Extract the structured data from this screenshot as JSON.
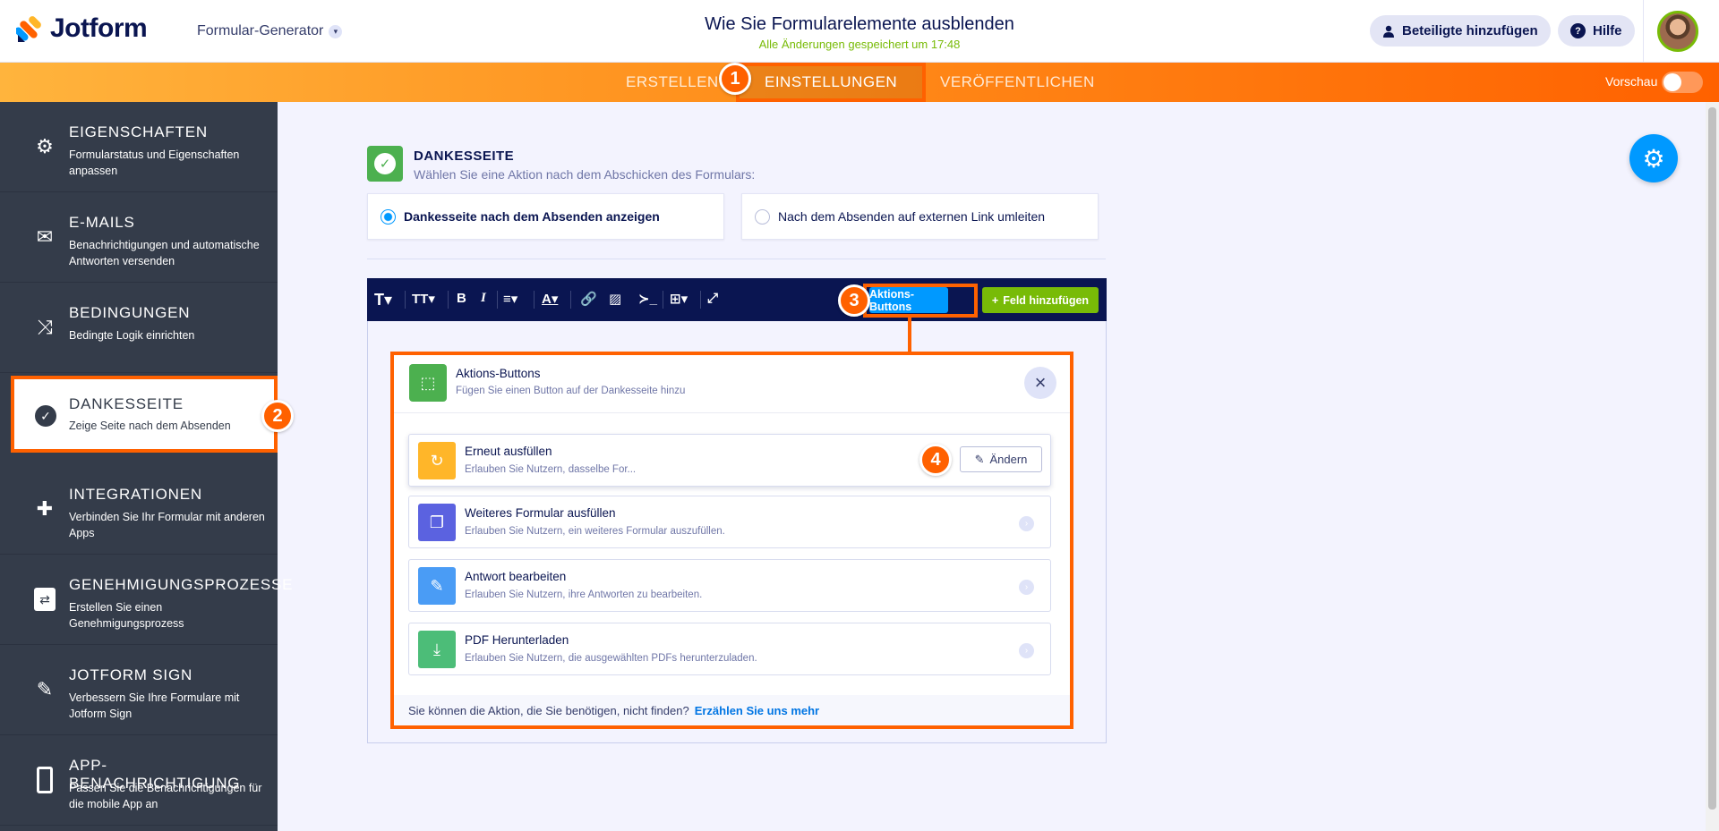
{
  "header": {
    "logo_text": "Jotform",
    "builder_label": "Formular-Generator",
    "form_title": "Wie Sie Formularelemente ausblenden",
    "saved_status": "Alle Änderungen gespeichert um 17:48",
    "invite_label": "Beteiligte hinzufügen",
    "help_label": "Hilfe"
  },
  "nav": {
    "tabs": [
      {
        "label": "ERSTELLEN"
      },
      {
        "label": "EINSTELLUNGEN"
      },
      {
        "label": "VERÖFFENTLICHEN"
      }
    ],
    "preview_label": "Vorschau"
  },
  "badges": [
    "1",
    "2",
    "3",
    "4"
  ],
  "sidebar": {
    "items": [
      {
        "title": "EIGENSCHAFTEN",
        "subtitle": "Formularstatus und Eigenschaften anpassen",
        "icon": "gear-icon"
      },
      {
        "title": "E-MAILS",
        "subtitle": "Benachrichtigungen und automatische Antworten versenden",
        "icon": "envelope-icon"
      },
      {
        "title": "BEDINGUNGEN",
        "subtitle": "Bedingte Logik einrichten",
        "icon": "shuffle-icon"
      },
      {
        "title": "DANKESSEITE",
        "subtitle": "Zeige Seite nach dem Absenden",
        "icon": "check-circle-icon"
      },
      {
        "title": "INTEGRATIONEN",
        "subtitle": "Verbinden Sie Ihr Formular mit anderen Apps",
        "icon": "puzzle-icon"
      },
      {
        "title": "GENEHMIGUNGSPROZESSE",
        "subtitle": "Erstellen Sie einen Genehmigungsprozess",
        "icon": "flow-icon"
      },
      {
        "title": "JOTFORM SIGN",
        "subtitle": "Verbessern Sie Ihre Formulare mit Jotform Sign",
        "icon": "pen-icon"
      },
      {
        "title": "APP-BENACHRICHTIGUNG",
        "subtitle": "Passen Sie die Benachrichtigungen für die mobile App an",
        "icon": "phone-icon"
      }
    ]
  },
  "thankyou": {
    "title": "DANKESSEITE",
    "subtitle": "Wählen Sie eine Aktion nach dem Abschicken des Formulars:",
    "option_show": "Dankesseite nach dem Absenden anzeigen",
    "option_redirect": "Nach dem Absenden auf externen Link umleiten"
  },
  "editor": {
    "action_buttons_label": "Aktions-Buttons",
    "add_field_label": "Feld hinzufügen"
  },
  "panel": {
    "title": "Aktions-Buttons",
    "subtitle": "Fügen Sie einen Button auf der Dankesseite hinzu",
    "cards": [
      {
        "title": "Erneut ausfüllen",
        "subtitle": "Erlauben Sie Nutzern, dasselbe For...",
        "color": "#ffb629"
      },
      {
        "title": "Weiteres Formular ausfüllen",
        "subtitle": "Erlauben Sie Nutzern, ein weiteres Formular auszufüllen.",
        "color": "#5b62e0"
      },
      {
        "title": "Antwort bearbeiten",
        "subtitle": "Erlauben Sie Nutzern, ihre Antworten zu bearbeiten.",
        "color": "#4a9cf5"
      },
      {
        "title": "PDF Herunterladen",
        "subtitle": "Erlauben Sie Nutzern, die ausgewählten PDFs herunterzuladen.",
        "color": "#4cbd78"
      }
    ],
    "edit_label": "Ändern",
    "footer_text": "Sie können die Aktion, die Sie benötigen, nicht finden?",
    "footer_link": "Erzählen Sie uns mehr"
  },
  "colors": {
    "accent": "#ff6100",
    "brand_navy": "#0a1551",
    "blue": "#0099ff",
    "green": "#78bb07"
  }
}
